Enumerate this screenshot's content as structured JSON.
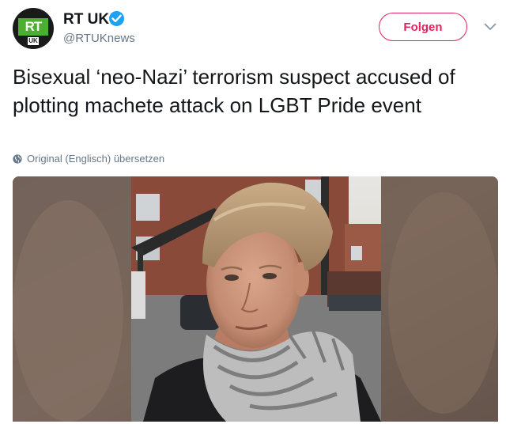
{
  "author": {
    "name": "RT UK",
    "handle": "@RTUKnews",
    "avatar_logo": "RT",
    "avatar_sublabel": "UK",
    "verified_icon": "verified-badge-icon"
  },
  "actions": {
    "follow_label": "Folgen",
    "more_icon": "chevron-down-icon"
  },
  "tweet": {
    "text": "Bisexual ‘neo-Nazi’ terrorism suspect accused of plotting machete attack on LGBT Pride event",
    "translate_label": "Original (Englisch) übersetzen",
    "translate_icon": "globe-icon"
  },
  "colors": {
    "follow_accent": "#e0245e",
    "verified": "#1da1f2",
    "rt_green": "#4caf2f",
    "secondary_text": "#657786"
  }
}
